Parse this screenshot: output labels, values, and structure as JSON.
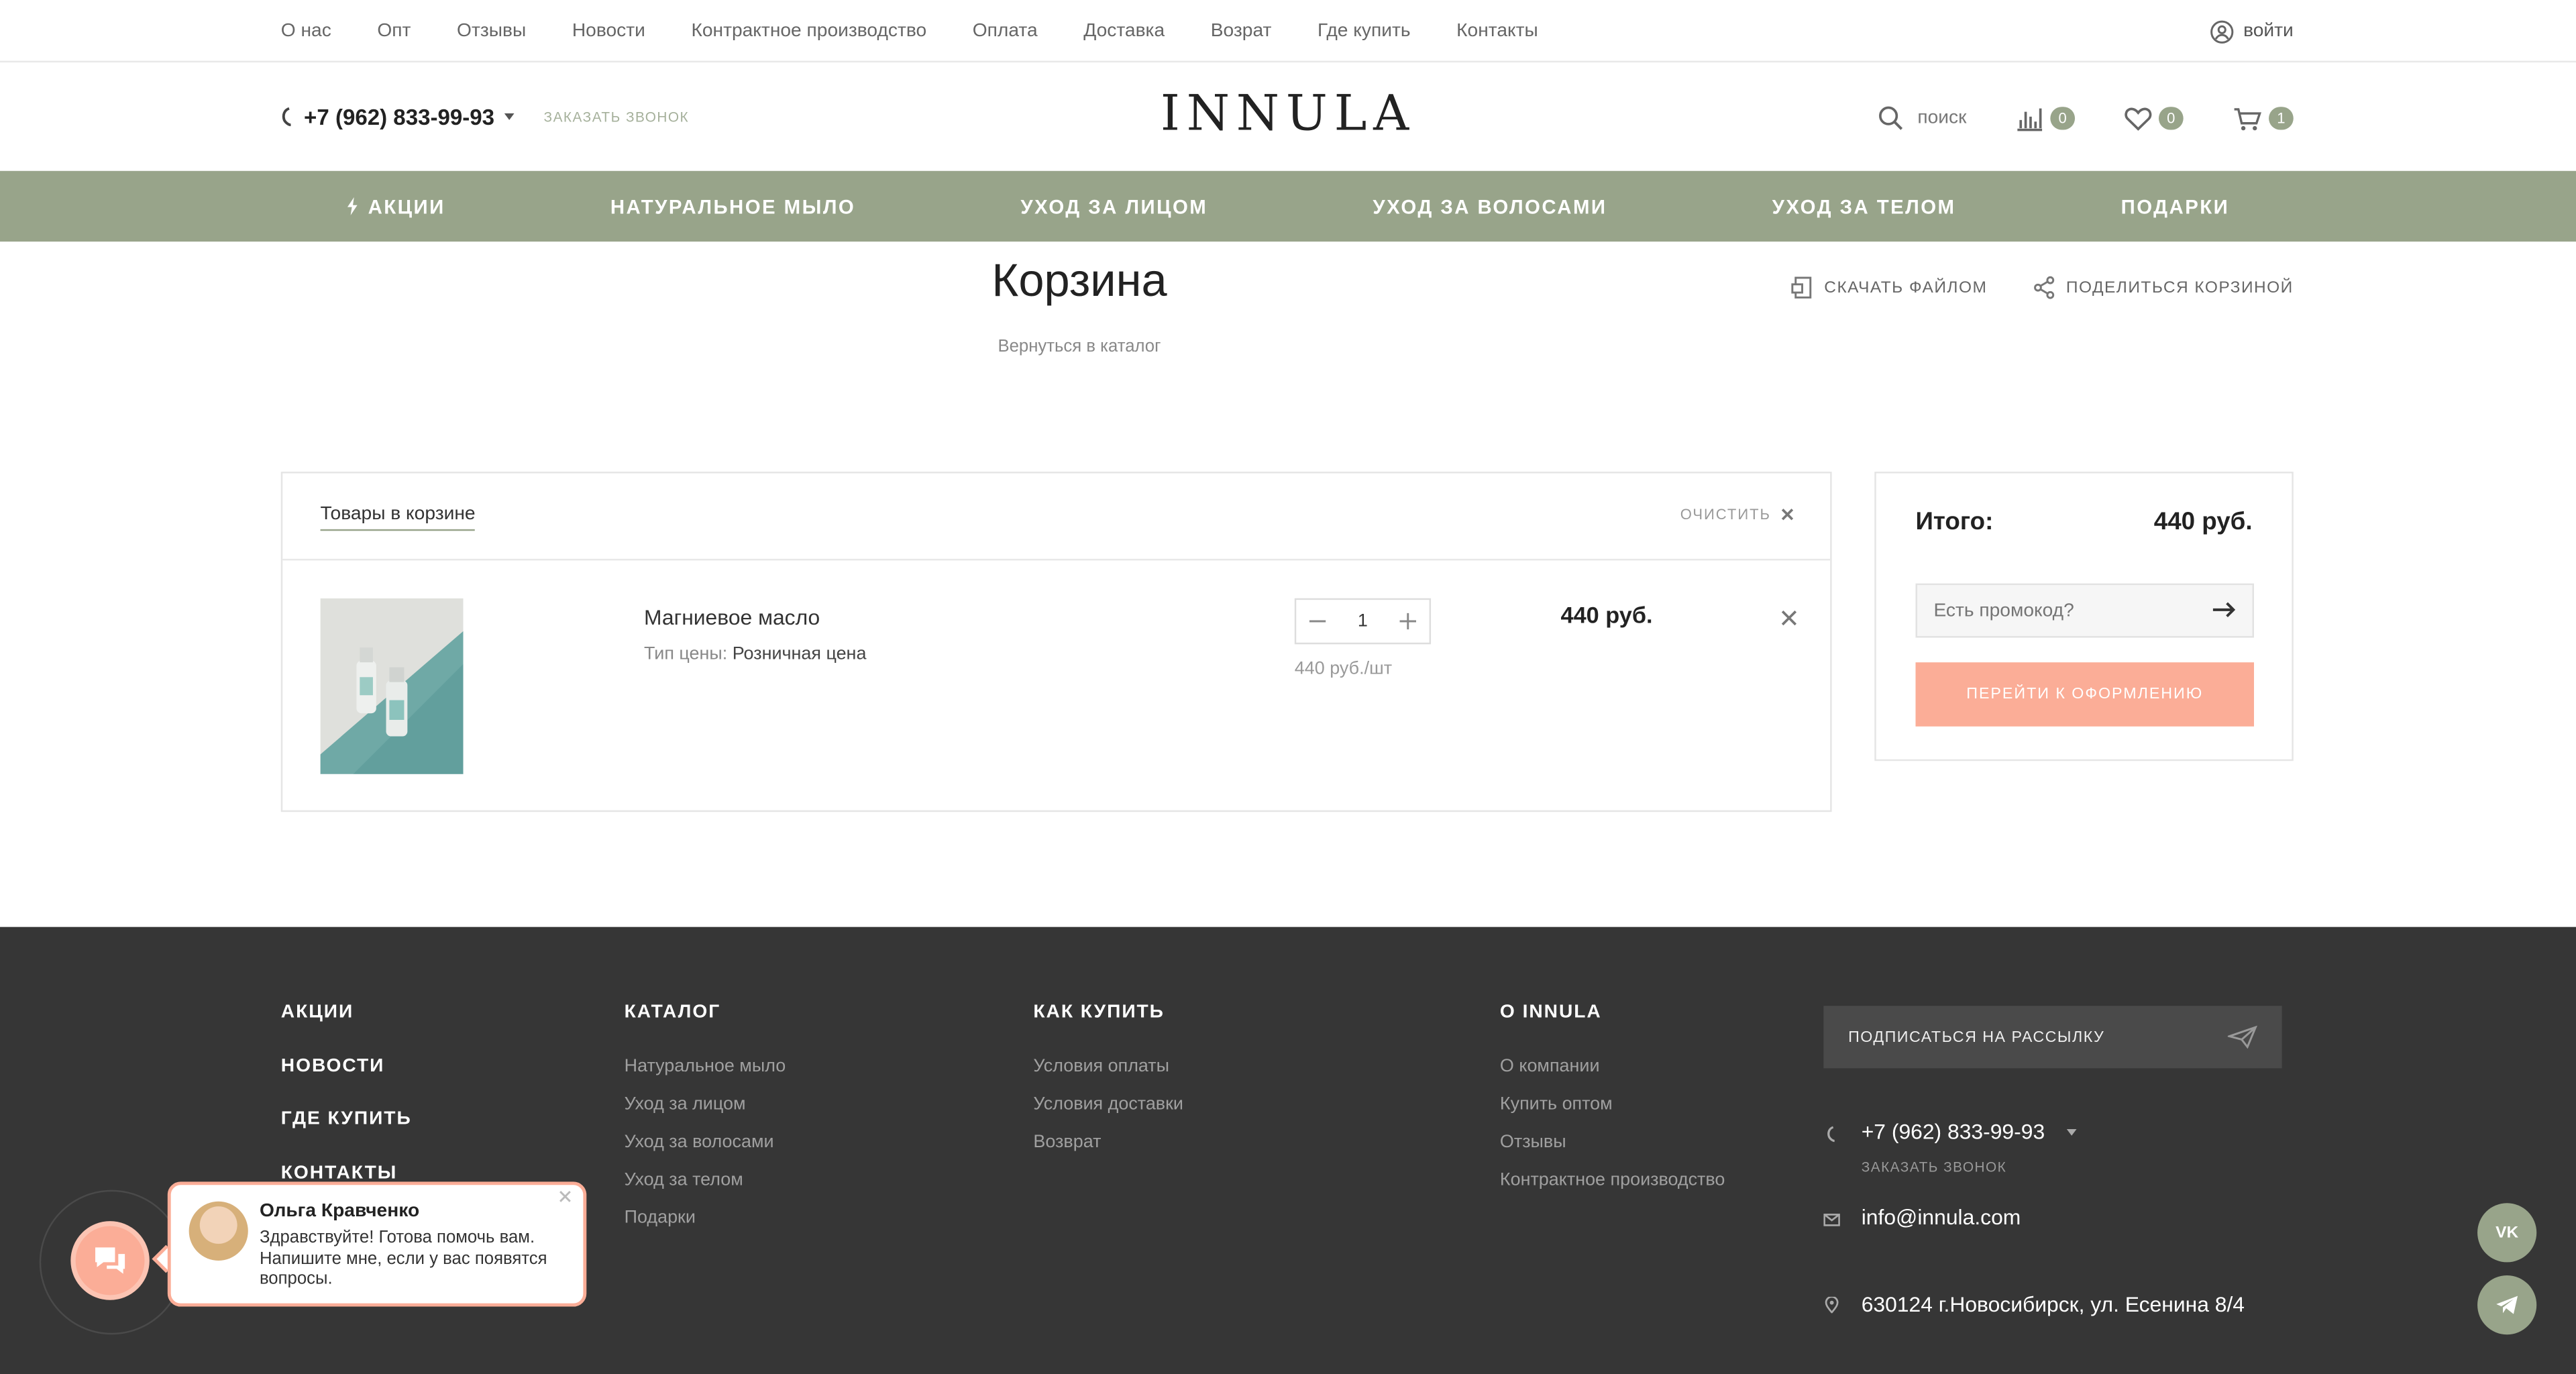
{
  "topnav": {
    "items": [
      "О нас",
      "Опт",
      "Отзывы",
      "Новости",
      "Контрактное производство",
      "Оплата",
      "Доставка",
      "Возрат",
      "Где купить",
      "Контакты"
    ],
    "login_label": "войти"
  },
  "header": {
    "phone": "+7 (962) 833-99-93",
    "callback": "заказать звонок",
    "logo": "INNULA",
    "search_label": "поиск",
    "compare_count": "0",
    "favorites_count": "0",
    "cart_count": "1"
  },
  "menu": {
    "items": [
      "Акции",
      "Натуральное мыло",
      "Уход за лицом",
      "Уход за волосами",
      "Уход за телом",
      "Подарки"
    ]
  },
  "page": {
    "title": "Корзина",
    "back_link": "Вернуться в каталог",
    "download_label": "Скачать файлом",
    "share_label": "Поделиться корзиной"
  },
  "cart": {
    "tab_label": "Товары в корзине",
    "clear_label": "очистить",
    "items": [
      {
        "name": "Магниевое масло",
        "price_type_label": "Тип цены:",
        "price_type_value": "Розничная цена",
        "quantity": "1",
        "unit_price": "440 руб./шт",
        "total": "440 руб."
      }
    ]
  },
  "summary": {
    "total_label": "Итого:",
    "total_value": "440 руб.",
    "promo_placeholder": "Есть промокод?",
    "checkout_label": "Перейти к оформлению"
  },
  "footer": {
    "col1": [
      "Акции",
      "Новости",
      "Где купить",
      "Контакты"
    ],
    "catalog": {
      "heading": "Каталог",
      "links": [
        "Натуральное мыло",
        "Уход за лицом",
        "Уход за волосами",
        "Уход за телом",
        "Подарки"
      ]
    },
    "how_to_buy": {
      "heading": "Как купить",
      "links": [
        "Условия оплаты",
        "Условия доставки",
        "Возврат"
      ]
    },
    "about": {
      "heading": "О INNULA",
      "links": [
        "О компании",
        "Купить оптом",
        "Отзывы",
        "Контрактное производство"
      ]
    },
    "subscribe_label": "Подписаться на рассылку",
    "phone": "+7 (962) 833-99-93",
    "callback": "заказать звонок",
    "email": "info@innula.com",
    "address": "630124 г.Новосибирск, ул. Есенина 8/4"
  },
  "chat": {
    "agent_name": "Ольга Кравченко",
    "message": "Здравствуйте! Готова помочь вам. Напишите мне, если у вас появятся вопросы."
  },
  "social": {
    "vk_label": "VK"
  },
  "colors": {
    "accent_green": "#98a48a",
    "accent_peach": "#fbad97",
    "footer_bg": "#363636"
  }
}
